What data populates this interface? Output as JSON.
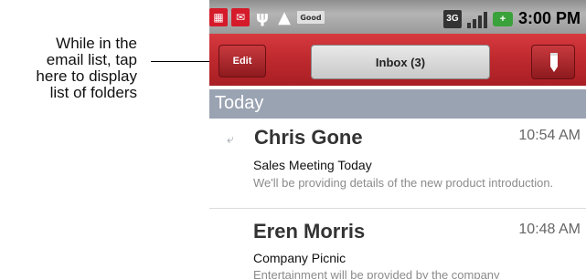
{
  "callout": {
    "lines": [
      "While in the",
      "email list, tap",
      "here to display",
      "list of folders"
    ]
  },
  "status_bar": {
    "icons": [
      "calendar-icon",
      "mail-icon",
      "usb-icon",
      "warning-icon",
      "good-icon",
      "3g-icon",
      "signal-icon",
      "battery-icon"
    ],
    "good_label": "Good",
    "network": "3G",
    "time": "3:00 PM"
  },
  "toolbar": {
    "edit_label": "Edit",
    "folder_label": "Inbox (3)",
    "compose_icon": "pencil-icon"
  },
  "section": {
    "label": "Today"
  },
  "messages": [
    {
      "sender": "Chris Gone",
      "time": "10:54 AM",
      "subject": "Sales Meeting Today",
      "preview": "We'll be providing details of the new product introduction.",
      "icon": "reply-icon"
    },
    {
      "sender": "Eren Morris",
      "time": "10:48 AM",
      "subject": "Company Picnic",
      "preview": "Entertainment will be provided by the company"
    }
  ],
  "colors": {
    "toolbar_red": "#c02a2f",
    "section_bar": "#9aa3b2",
    "status_bar": "#9a9a9a"
  }
}
